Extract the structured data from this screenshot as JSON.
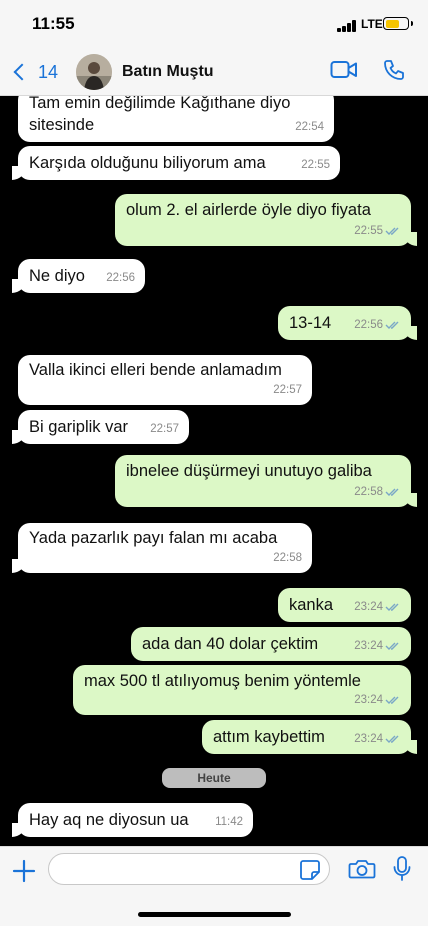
{
  "status": {
    "time": "11:55",
    "network": "LTE"
  },
  "header": {
    "back_count": "14",
    "contact_name": "Batın Muştu"
  },
  "messages": [
    {
      "dir": "in",
      "text": "Tam emin değilimde Kağıthane diyo sitesinde",
      "time": "22:54"
    },
    {
      "dir": "in",
      "text": "Karşıda olduğunu biliyorum ama",
      "time": "22:55"
    },
    {
      "dir": "out",
      "text": "olum 2. el airlerde öyle diyo fiyata",
      "time": "22:55"
    },
    {
      "dir": "in",
      "text": "Ne diyo",
      "time": "22:56"
    },
    {
      "dir": "out",
      "text": "13-14",
      "time": "22:56"
    },
    {
      "dir": "in",
      "text": "Valla ikinci elleri bende anlamadım",
      "time": "22:57"
    },
    {
      "dir": "in",
      "text": "Bi gariplik var",
      "time": "22:57"
    },
    {
      "dir": "out",
      "text": "ibnelee düşürmeyi unutuyo galiba",
      "time": "22:58"
    },
    {
      "dir": "in",
      "text": "Yada pazarlık payı falan mı acaba",
      "time": "22:58"
    },
    {
      "dir": "out",
      "text": "kanka",
      "time": "23:24"
    },
    {
      "dir": "out",
      "text": "ada dan 40 dolar çektim",
      "time": "23:24"
    },
    {
      "dir": "out",
      "text": "max 500 tl atılıyomuş benim yöntemle",
      "time": "23:24"
    },
    {
      "dir": "out",
      "text": "attım kaybettim",
      "time": "23:24"
    },
    {
      "dir": "in",
      "text": "Hay aq ne diyosun ua",
      "time": "11:42"
    }
  ],
  "date_divider": "Heute",
  "composer": {
    "placeholder": ""
  },
  "colors": {
    "accent": "#1a73d8",
    "outgoing_bubble": "#dcf8c6",
    "incoming_bubble": "#ffffff",
    "chat_bg": "#000000",
    "tick": "#7aa7c7"
  }
}
